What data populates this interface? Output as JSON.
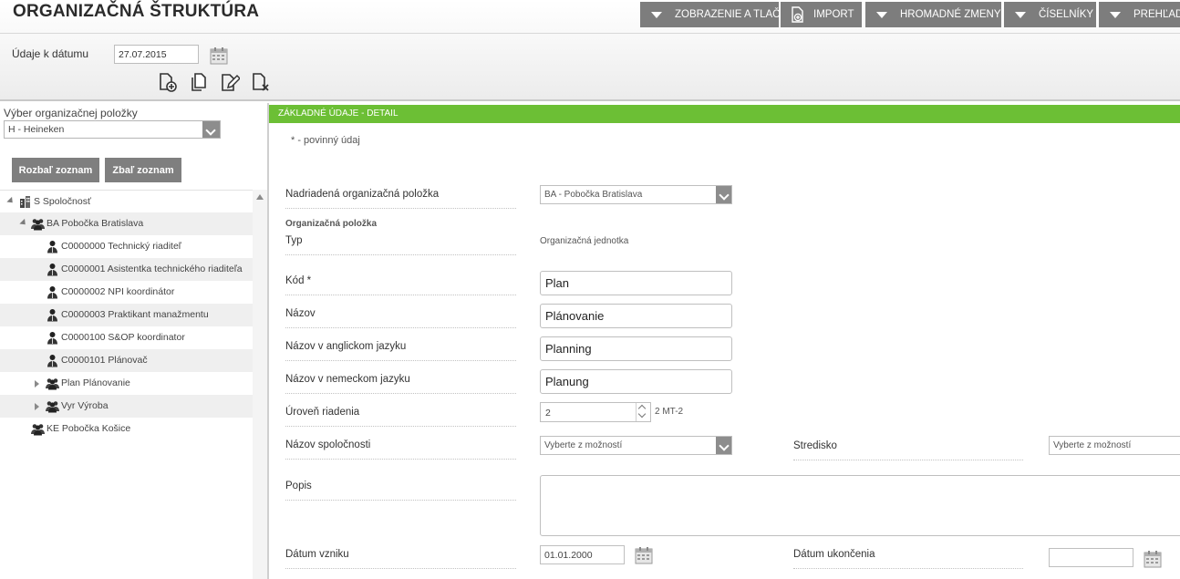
{
  "header": {
    "title": "ORGANIZAČNÁ ŠTRUKTÚRA",
    "menu": [
      {
        "label": "ZOBRAZENIE A TLAČ",
        "icon": "caret-down-icon"
      },
      {
        "label": "IMPORT",
        "icon": "import-icon"
      },
      {
        "label": "HROMADNÉ ZMENY",
        "icon": "caret-down-icon"
      },
      {
        "label": "ČÍSELNÍKY",
        "icon": "caret-down-icon"
      },
      {
        "label": "PREHĽADY",
        "icon": "caret-down-icon"
      }
    ],
    "date_label": "Údaje k dátumu",
    "date_value": "27.07.2015",
    "tools": [
      "add-item-icon",
      "copy-item-icon",
      "edit-item-icon",
      "delete-item-icon"
    ]
  },
  "left_panel": {
    "select_label": "Výber organizačnej položky",
    "select_value": "H - Heineken",
    "expand_button": "Rozbaľ zoznam",
    "collapse_button": "Zbaľ zoznam",
    "tree": [
      {
        "label": "S Spoločnosť",
        "icon": "building-icon",
        "level": 0,
        "expander": "open"
      },
      {
        "label": "BA Pobočka Bratislava",
        "icon": "group-icon",
        "level": 1,
        "expander": "open"
      },
      {
        "label": "C0000000 Technický riaditeľ",
        "icon": "person-icon",
        "level": 2,
        "expander": "none"
      },
      {
        "label": "C0000001 Asistentka technického riaditeľa",
        "icon": "person-icon",
        "level": 2,
        "expander": "none"
      },
      {
        "label": "C0000002 NPI koordinátor",
        "icon": "person-icon",
        "level": 2,
        "expander": "none"
      },
      {
        "label": "C0000003 Praktikant manažmentu",
        "icon": "person-icon",
        "level": 2,
        "expander": "none"
      },
      {
        "label": "C0000100 S&OP koordinator",
        "icon": "person-icon",
        "level": 2,
        "expander": "none"
      },
      {
        "label": "C0000101 Plánovač",
        "icon": "person-icon",
        "level": 2,
        "expander": "none"
      },
      {
        "label": "Plan Plánovanie",
        "icon": "group-icon",
        "level": 2,
        "expander": "closed"
      },
      {
        "label": "Vyr Výroba",
        "icon": "group-icon",
        "level": 2,
        "expander": "closed"
      },
      {
        "label": "KE Pobočka Košice",
        "icon": "group-icon",
        "level": 1,
        "expander": "none"
      }
    ]
  },
  "detail": {
    "section_title": "ZÁKLADNÉ ÚDAJE - DETAIL",
    "required_note": "* - povinný údaj",
    "parent_label": "Nadriadená organizačná položka",
    "parent_value": "BA - Pobočka Bratislava",
    "org_item_heading": "Organizačná položka",
    "type_label": "Typ",
    "type_value": "Organizačná jednotka",
    "code_label": "Kód *",
    "code_value": "Plan",
    "name_label": "Názov",
    "name_value": "Plánovanie",
    "name_en_label": "Názov v anglickom jazyku",
    "name_en_value": "Planning",
    "name_de_label": "Názov v nemeckom jazyku",
    "name_de_value": "Planung",
    "level_label": "Úroveň riadenia",
    "level_value": "2",
    "level_suffix": "2 MT-2",
    "company_label": "Názov spoločnosti",
    "company_placeholder": "Vyberte z možností",
    "center_label": "Stredisko",
    "center_placeholder": "Vyberte z možností",
    "desc_label": "Popis",
    "created_label": "Dátum vzniku",
    "created_value": "01.01.2000",
    "ended_label": "Dátum ukončenia",
    "ended_value": ""
  },
  "colors": {
    "menu_bg": "#7d7d7d",
    "section_green": "#6cbf35",
    "button_gray": "#7f7f7f"
  }
}
